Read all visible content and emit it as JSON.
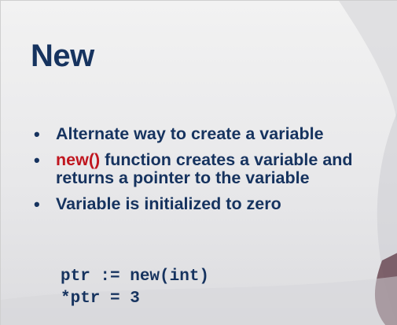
{
  "slide": {
    "title": "New",
    "bullets": [
      {
        "text": "Alternate way to create a variable"
      },
      {
        "highlight": "new()",
        "text": " function creates a variable and returns a pointer to the variable"
      },
      {
        "text": "Variable is initialized to zero"
      }
    ],
    "code_lines": [
      "ptr := new(int)",
      "*ptr = 3"
    ],
    "colors": {
      "title": "#16335f",
      "highlight": "#c0161f",
      "background": "#eeeeee"
    }
  }
}
